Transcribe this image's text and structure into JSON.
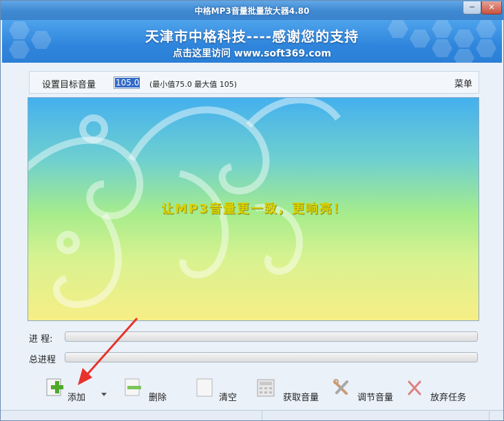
{
  "window": {
    "title": "中格MP3音量批量放大器4.80",
    "minimize_glyph": "─",
    "close_glyph": "✕"
  },
  "banner": {
    "line1": "天津市中格科技----感谢您的支持",
    "line2": "点击这里访问 www.soft369.com"
  },
  "settings": {
    "target_label": "设置目标音量",
    "target_value": "105.0",
    "range_text": "(最小值75.0  最大值 105)",
    "menu_label": "菜单"
  },
  "stage": {
    "slogan": "让MP3音量更一致，更响亮！"
  },
  "progress": {
    "current_label": "进  程:",
    "current_value": 0,
    "total_label": "总进程",
    "total_value": 0
  },
  "toolbar": {
    "add": "添加",
    "delete": "删除",
    "clear": "清空",
    "get_volume": "获取音量",
    "adjust_volume": "调节音量",
    "abort": "放弃任务"
  },
  "colors": {
    "accent": "#2f85db",
    "slogan": "#d8d200",
    "arrow": "#e8322c"
  }
}
